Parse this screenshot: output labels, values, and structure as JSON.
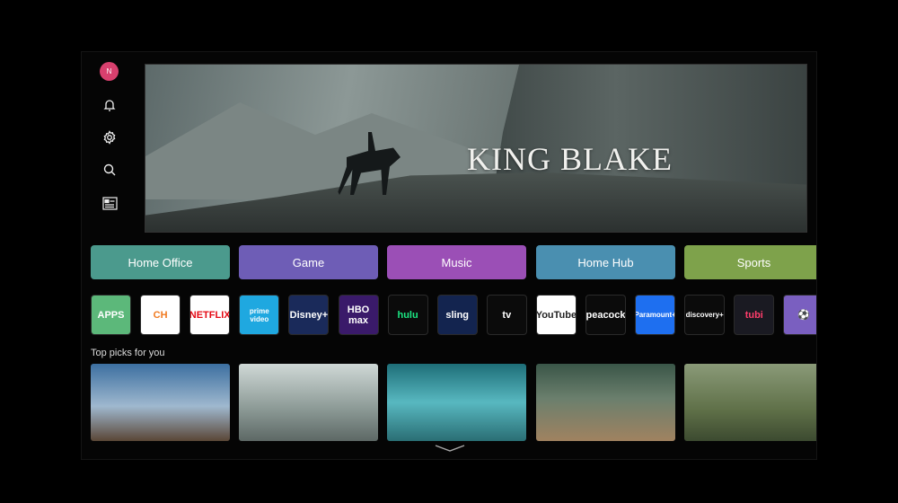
{
  "sidebar": {
    "avatar_initial": "N",
    "icons": [
      "bell-icon",
      "gear-icon",
      "search-icon",
      "guide-icon"
    ]
  },
  "banner": {
    "title": "KING BLAKE"
  },
  "categories": [
    {
      "label": "Home Office",
      "color": "#4b9a8d"
    },
    {
      "label": "Game",
      "color": "#6e5db6"
    },
    {
      "label": "Music",
      "color": "#9b4fb6"
    },
    {
      "label": "Home Hub",
      "color": "#4a8fb0"
    },
    {
      "label": "Sports",
      "color": "#7ea24b"
    }
  ],
  "apps": [
    {
      "label": "APPS",
      "bg": "#5cb87a",
      "fg": "#fff"
    },
    {
      "label": "CH",
      "bg": "#ffffff",
      "fg": "#f07a20"
    },
    {
      "label": "NETFLIX",
      "bg": "#ffffff",
      "fg": "#e50914"
    },
    {
      "label": "prime video",
      "bg": "#1fa8e0",
      "fg": "#fff"
    },
    {
      "label": "Disney+",
      "bg": "#1a2a5a",
      "fg": "#fff"
    },
    {
      "label": "HBO max",
      "bg": "#3a1a6a",
      "fg": "#fff"
    },
    {
      "label": "hulu",
      "bg": "#0b0b0b",
      "fg": "#1ce783"
    },
    {
      "label": "sling",
      "bg": "#13244f",
      "fg": "#fff"
    },
    {
      "label": "tv",
      "bg": "#0b0b0b",
      "fg": "#fff"
    },
    {
      "label": "YouTube",
      "bg": "#ffffff",
      "fg": "#222"
    },
    {
      "label": "peacock",
      "bg": "#0b0b0b",
      "fg": "#fff"
    },
    {
      "label": "Paramount+",
      "bg": "#1e6ff0",
      "fg": "#fff"
    },
    {
      "label": "discovery+",
      "bg": "#0b0b0b",
      "fg": "#fff"
    },
    {
      "label": "tubi",
      "bg": "#1a1a22",
      "fg": "#ff3d6b"
    },
    {
      "label": "⚽",
      "bg": "#7a5fc0",
      "fg": "#fff"
    }
  ],
  "picks": {
    "label": "Top picks for you",
    "thumbs": [
      "linear-gradient(180deg,#3c6fa0,#9fb8cf 55%,#5a4636)",
      "linear-gradient(180deg,#cfd8d6,#8a9894 60%,#5d6865)",
      "linear-gradient(180deg,#1e6e78,#58b8c0 50%,#2a6e74)",
      "linear-gradient(180deg,#3a5648,#6b7f6d 45%,#a08260)",
      "linear-gradient(180deg,#8a9a78,#5f7048 60%,#3c4a30)"
    ]
  }
}
